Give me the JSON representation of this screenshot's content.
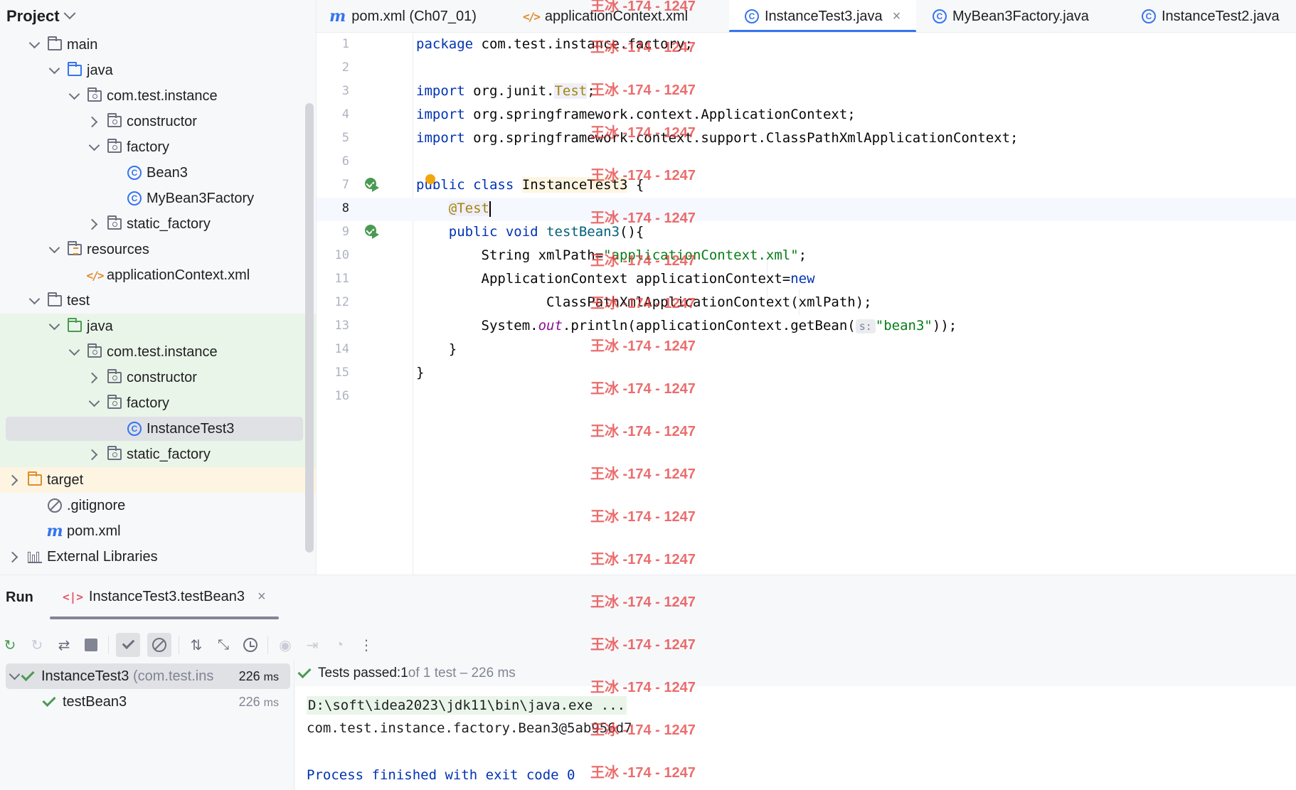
{
  "project_panel": {
    "title": "Project",
    "tree": [
      {
        "label": "main",
        "indent": 1,
        "arrow": "down",
        "icon": "folder-icon"
      },
      {
        "label": "java",
        "indent": 2,
        "arrow": "down",
        "icon": "java-source-folder-icon"
      },
      {
        "label": "com.test.instance",
        "indent": 3,
        "arrow": "down",
        "icon": "package-icon"
      },
      {
        "label": "constructor",
        "indent": 4,
        "arrow": "right",
        "icon": "package-icon"
      },
      {
        "label": "factory",
        "indent": 4,
        "arrow": "down",
        "icon": "package-icon"
      },
      {
        "label": "Bean3",
        "indent": 5,
        "arrow": "none",
        "icon": "java-class-icon"
      },
      {
        "label": "MyBean3Factory",
        "indent": 5,
        "arrow": "none",
        "icon": "java-class-icon"
      },
      {
        "label": "static_factory",
        "indent": 4,
        "arrow": "right",
        "icon": "package-icon"
      },
      {
        "label": "resources",
        "indent": 2,
        "arrow": "down",
        "icon": "resources-folder-icon"
      },
      {
        "label": "applicationContext.xml",
        "indent": 3,
        "arrow": "none",
        "icon": "xml-file-icon"
      },
      {
        "label": "test",
        "indent": 1,
        "arrow": "down",
        "icon": "folder-icon"
      },
      {
        "label": "java",
        "indent": 2,
        "arrow": "down",
        "icon": "test-source-folder-icon"
      },
      {
        "label": "com.test.instance",
        "indent": 3,
        "arrow": "down",
        "icon": "package-icon"
      },
      {
        "label": "constructor",
        "indent": 4,
        "arrow": "right",
        "icon": "package-icon"
      },
      {
        "label": "factory",
        "indent": 4,
        "arrow": "down",
        "icon": "package-icon"
      },
      {
        "label": "InstanceTest3",
        "indent": 5,
        "arrow": "none",
        "icon": "java-class-icon"
      },
      {
        "label": "static_factory",
        "indent": 4,
        "arrow": "right",
        "icon": "package-icon"
      },
      {
        "label": "target",
        "indent": 0,
        "arrow": "right",
        "icon": "excluded-folder-icon"
      },
      {
        "label": ".gitignore",
        "indent": 1,
        "arrow": "none",
        "icon": "gitignore-icon"
      },
      {
        "label": "pom.xml",
        "indent": 1,
        "arrow": "none",
        "icon": "maven-icon"
      },
      {
        "label": "External Libraries",
        "indent": 0,
        "arrow": "right",
        "icon": "libraries-icon"
      }
    ]
  },
  "editor_tabs": [
    {
      "label": "pom.xml (Ch07_01)",
      "icon": "maven-icon",
      "active": false
    },
    {
      "label": "applicationContext.xml",
      "icon": "xml-file-icon",
      "active": false
    },
    {
      "label": "InstanceTest3.java",
      "icon": "java-class-icon",
      "active": true
    },
    {
      "label": "MyBean3Factory.java",
      "icon": "java-class-icon",
      "active": false
    },
    {
      "label": "InstanceTest2.java",
      "icon": "java-class-icon",
      "active": false
    }
  ],
  "editor": {
    "line_numbers": [
      "1",
      "2",
      "3",
      "4",
      "5",
      "6",
      "7",
      "8",
      "9",
      "10",
      "11",
      "12",
      "13",
      "14",
      "15",
      "16"
    ],
    "lines": {
      "l1": {
        "kw": "package",
        "rest": " com.test.instance.factory;"
      },
      "l3": {
        "kw": "import",
        "pre": " org.junit.",
        "ann": "Test",
        "post": ";"
      },
      "l4": {
        "kw": "import",
        "rest": " org.springframework.context.ApplicationContext;"
      },
      "l5": {
        "kw": "import",
        "rest": " org.springframework.context.support.ClassPathXmlApplicationContext;"
      },
      "l7": {
        "kw1": "public",
        "kw2": "class",
        "cls": "InstanceTest3",
        "rest": " {"
      },
      "l8": {
        "ann": "@Test"
      },
      "l9": {
        "kw1": "public",
        "kw2": "void",
        "method": "testBean3",
        "rest": "(){"
      },
      "l10": {
        "pre": "String xmlPath=",
        "str": "\"applicationContext.xml\"",
        "post": ";"
      },
      "l11": {
        "pre": "ApplicationContext applicationContext=",
        "kw": "new"
      },
      "l12": {
        "rest": "ClassPathXmlApplicationContext(xmlPath);"
      },
      "l13": {
        "pre": "System.",
        "field": "out",
        "mid": ".println(applicationContext.getBean(",
        "hint": "s:",
        "str": "\"bean3\"",
        "post": "));"
      },
      "l14": {
        "rest": "}"
      },
      "l15": {
        "rest": "}"
      }
    }
  },
  "run_panel": {
    "title": "Run",
    "tab_label": "InstanceTest3.testBean3",
    "test_tree": {
      "root": {
        "name": "InstanceTest3",
        "pkg": "(com.test.ins",
        "duration": "226",
        "unit": "ms"
      },
      "child": {
        "name": "testBean3",
        "duration": "226",
        "unit": "ms"
      }
    },
    "status": {
      "prefix": "Tests passed: ",
      "passed": "1",
      "suffix": " of 1 test – 226 ms"
    },
    "console": {
      "cmd": "D:\\soft\\idea2023\\jdk11\\bin\\java.exe ...",
      "output": "com.test.instance.factory.Bean3@5ab956d7",
      "exit": "Process finished with exit code 0"
    }
  },
  "watermark": {
    "text": "王冰 -174 - 1247"
  },
  "colors": {
    "accent": "#3574f0",
    "keyword": "#0033b3",
    "string": "#067d17",
    "annotation": "#9e880d",
    "pass": "#4b9a52",
    "watermark": "#e63c3c"
  }
}
